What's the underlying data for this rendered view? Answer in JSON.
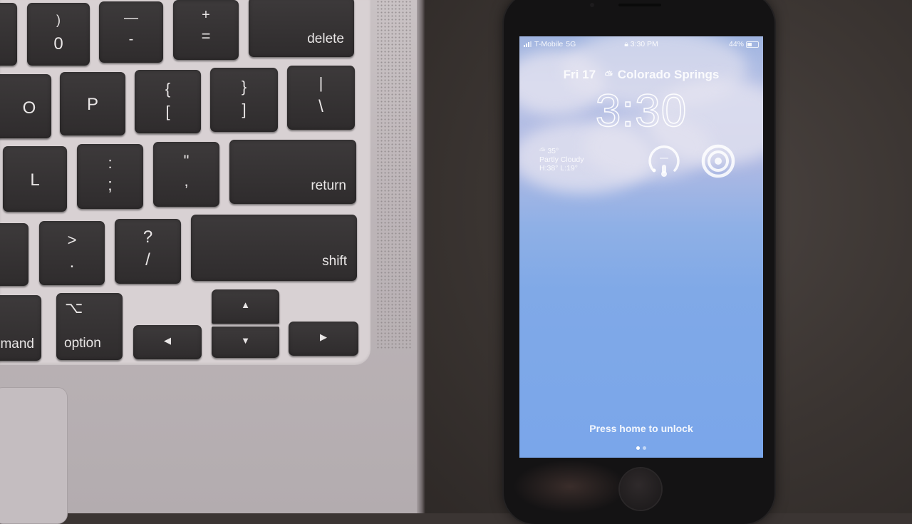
{
  "keyboard": {
    "keys": {
      "zero": {
        "top": ")",
        "bottom": "0"
      },
      "minus": {
        "top": "—",
        "bottom": "-"
      },
      "equals": {
        "top": "+",
        "bottom": "="
      },
      "delete": "delete",
      "o": "O",
      "p": "P",
      "bracket_left": {
        "top": "{",
        "bottom": "["
      },
      "bracket_right": {
        "top": "}",
        "bottom": "]"
      },
      "backslash": {
        "top": "|",
        "bottom": "\\"
      },
      "l": "L",
      "semicolon": {
        "top": ":",
        "bottom": ";"
      },
      "quote": {
        "top": "\"",
        "bottom": ","
      },
      "return": "return",
      "period": {
        "top": ">",
        "bottom": "."
      },
      "slash": {
        "top": "?",
        "bottom": "/"
      },
      "shift": "shift",
      "command": "mand",
      "option": {
        "symbol": "⌥",
        "label": "option"
      },
      "arrow_left": "◀",
      "arrow_up": "▲",
      "arrow_down": "▼",
      "arrow_right": "▶"
    }
  },
  "phone": {
    "status_bar": {
      "carrier": "T-Mobile",
      "network": "5G",
      "lock_icon": "lock-icon",
      "time": "3:30 PM",
      "battery_percent": "44%",
      "battery_level": 0.44
    },
    "lock_screen": {
      "date": "Fri 17",
      "weather_icon": "partly-cloudy-icon",
      "location": "Colorado Springs",
      "time": "3:30",
      "weather_widget": {
        "temperature": "35°",
        "condition": "Partly Cloudy",
        "high_low": "H:38° L:19°"
      },
      "gauge_widget_icon": "thermometer-gauge-icon",
      "rings_widget_icon": "concentric-rings-icon",
      "unlock_prompt": "Press home to unlock",
      "page_count": 2,
      "active_page": 1
    }
  }
}
